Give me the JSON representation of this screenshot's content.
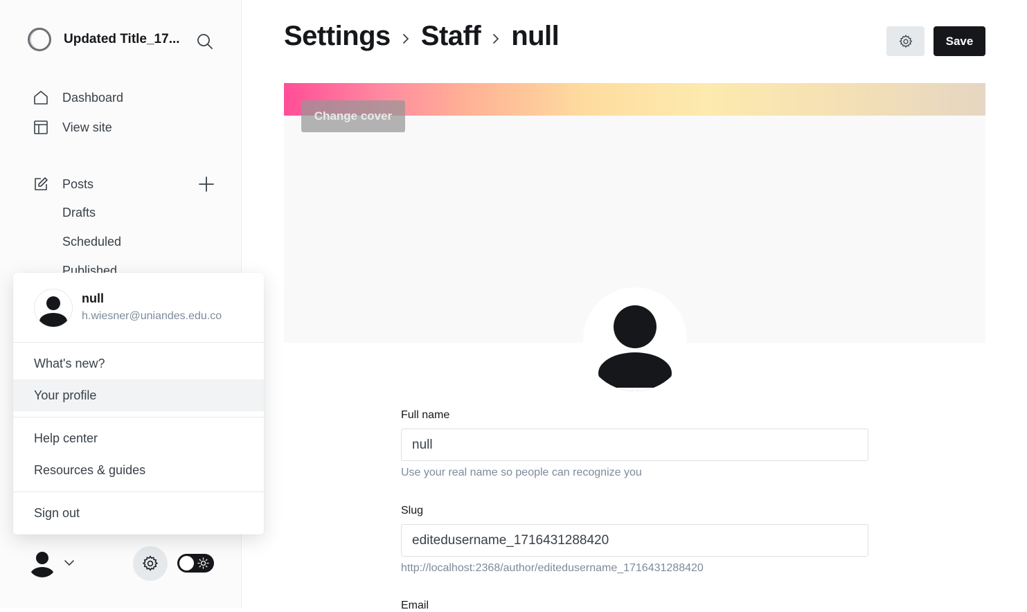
{
  "sidebar": {
    "site_title": "Updated Title_17...",
    "nav": {
      "dashboard": "Dashboard",
      "view_site": "View site",
      "posts": "Posts",
      "drafts": "Drafts",
      "scheduled": "Scheduled",
      "published": "Published"
    }
  },
  "user_menu": {
    "name": "null",
    "email": "h.wiesner@uniandes.edu.co",
    "items": [
      "What's new?",
      "Your profile",
      "Help center",
      "Resources & guides",
      "Sign out"
    ],
    "active_item": "Your profile"
  },
  "header": {
    "breadcrumb": [
      "Settings",
      "Staff",
      "null"
    ],
    "save_label": "Save"
  },
  "cover": {
    "change_cover_label": "Change cover"
  },
  "form": {
    "full_name": {
      "label": "Full name",
      "value": "null",
      "hint": "Use your real name so people can recognize you"
    },
    "slug": {
      "label": "Slug",
      "value": "editedusername_1716431288420",
      "hint": "http://localhost:2368/author/editedusername_1716431288420"
    },
    "email": {
      "label": "Email"
    }
  },
  "colors": {
    "primary": "#15171a",
    "muted_text": "#7c8b9a",
    "cover_gradient_start": "#ff4d97",
    "cover_gradient_end": "#e6d6c2"
  },
  "icons": [
    "search-icon",
    "home-icon",
    "layout-icon",
    "edit-icon",
    "plus-icon",
    "chevron-right-icon",
    "gear-icon",
    "chevron-down-icon",
    "sun-icon",
    "user-avatar-icon"
  ]
}
